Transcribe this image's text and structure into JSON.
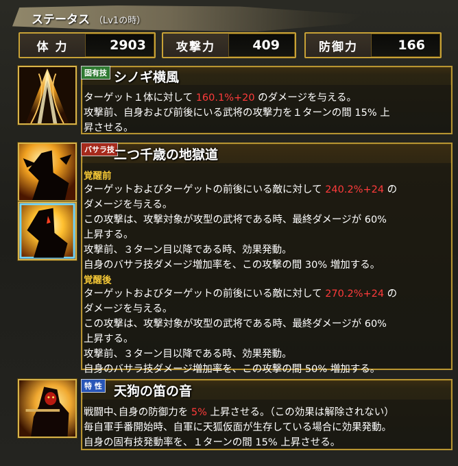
{
  "header": {
    "title": "ステータス",
    "subtitle": "（Lv1の時）"
  },
  "stats": [
    {
      "label": "体 力",
      "value": "2903"
    },
    {
      "label": "攻撃力",
      "value": "409"
    },
    {
      "label": "防御力",
      "value": "166"
    }
  ],
  "skill1": {
    "tag": "固有技",
    "name": "シノギ横風",
    "line1_a": "ターゲット１体に対して ",
    "line1_hl": "160.1%+20",
    "line1_b": " のダメージを与える。",
    "line2": "攻撃前、自身および前後にいる武将の攻撃力を１ターンの間 15% 上",
    "line3": "昇させる。"
  },
  "skill2": {
    "tag": "バサラ技",
    "name": "二つ千歳の地獄道",
    "before_label": "覚醒前",
    "before_l1_a": "ターゲットおよびターゲットの前後にいる敵に対して ",
    "before_l1_hl": "240.2%+24",
    "before_l1_b": " の",
    "before_l2": "ダメージを与える。",
    "before_l3": "この攻撃は、攻撃対象が攻型の武将である時、最終ダメージが 60%",
    "before_l4": "上昇する。",
    "before_l5": "攻撃前、３ターン目以降である時、効果発動。",
    "before_l6": "自身のバサラ技ダメージ増加率を、この攻撃の間 30% 増加する。",
    "after_label": "覚醒後",
    "after_l1_a": "ターゲットおよびターゲットの前後にいる敵に対して ",
    "after_l1_hl": "270.2%+24",
    "after_l1_b": " の",
    "after_l2": "ダメージを与える。",
    "after_l3": "この攻撃は、攻撃対象が攻型の武将である時、最終ダメージが 60%",
    "after_l4": "上昇する。",
    "after_l5": "攻撃前、３ターン目以降である時、効果発動。",
    "after_l6": "自身のバサラ技ダメージ増加率を、この攻撃の間 50% 増加する。"
  },
  "skill3": {
    "tag": "特 性",
    "name": "天狗の笛の音",
    "line1_a": "戦闘中､自身の防御力を ",
    "line1_hl": "5%",
    "line1_b": " 上昇させる。（この効果は解除されない）",
    "line2": "毎自軍手番開始時、自軍に天狐仮面が生存している場合に効果発動。",
    "line3": "自身の固有技発動率を、１ターンの間 15% 上昇させる。"
  },
  "colors": {
    "accent_gold": "#c8a236",
    "highlight_red": "#ff3b3b",
    "phase_yellow": "#f5c836"
  },
  "icons": [
    "skill-wind-icon",
    "basara-skill-icon",
    "basara-awakened-icon",
    "tengu-trait-icon"
  ]
}
